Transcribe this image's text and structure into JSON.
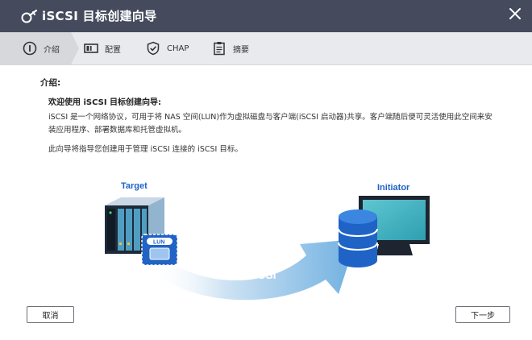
{
  "window": {
    "title": "iSCSI 目标创建向导"
  },
  "steps": [
    {
      "label": "介绍",
      "icon": "info-icon",
      "active": true
    },
    {
      "label": "配置",
      "icon": "config-icon",
      "active": false
    },
    {
      "label": "CHAP",
      "icon": "shield-check-icon",
      "active": false
    },
    {
      "label": "摘要",
      "icon": "clipboard-icon",
      "active": false
    }
  ],
  "content": {
    "heading": "介绍:",
    "welcome": "欢迎使用 iSCSI 目标创建向导:",
    "p1": "iSCSI 是一个网络协议，可用于将 NAS 空间(LUN)作为虚拟磁盘与客户端(iSCSI 启动器)共享。客户端随后便可灵活使用此空间来安装应用程序、部署数据库和托管虚拟机。",
    "p2": "此向导将指导您创建用于管理 iSCSI 连接的 iSCSI 目标。"
  },
  "illustration": {
    "target_label": "Target",
    "initiator_label": "Initiator",
    "lun_label": "LUN",
    "iscsi_label": "iSCSI"
  },
  "buttons": {
    "cancel": "取消",
    "next": "下一步"
  },
  "colors": {
    "titlebar": "#454b5d",
    "accent_blue": "#1f63c6",
    "teal": "#2ea3b4"
  }
}
